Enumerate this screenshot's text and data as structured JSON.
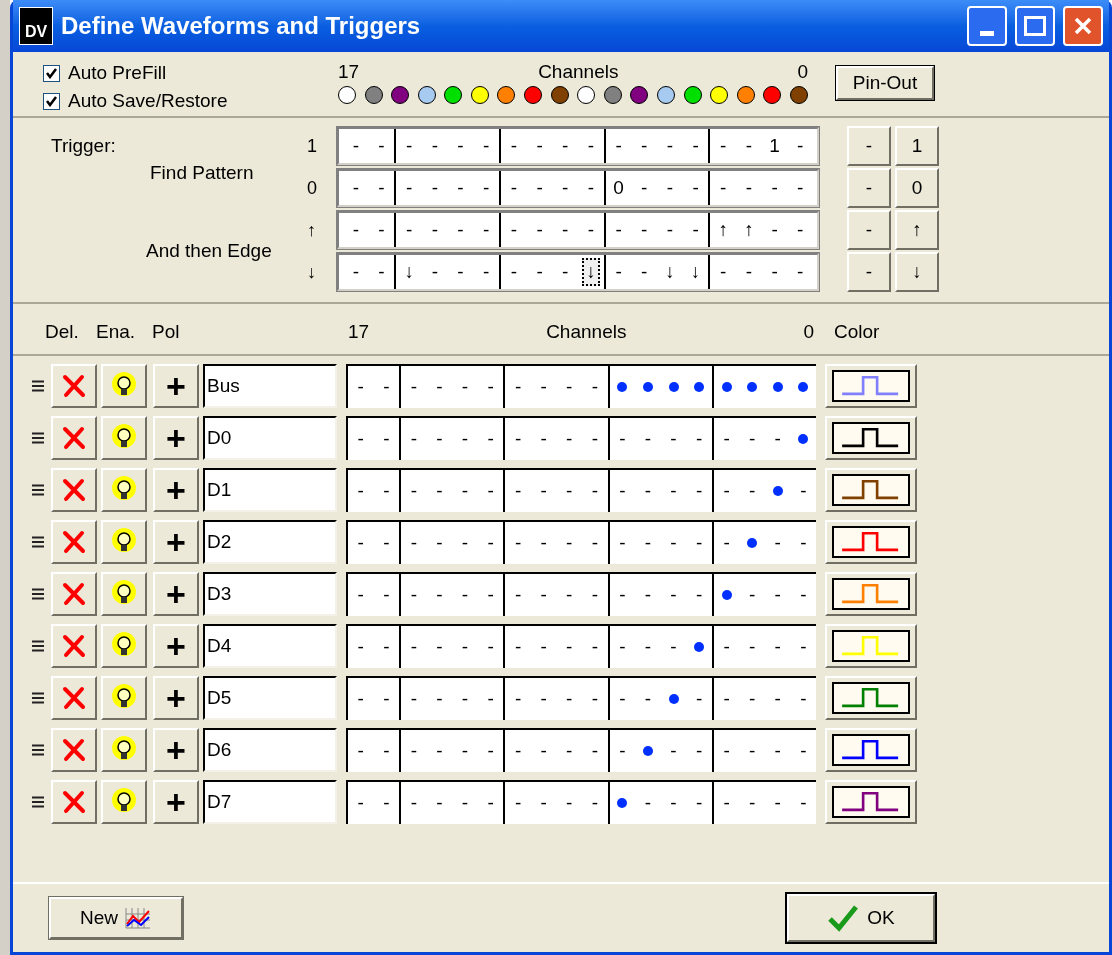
{
  "window": {
    "title": "Define Waveforms and Triggers",
    "logo": "DV"
  },
  "options": [
    {
      "label": "Auto PreFill",
      "checked": true
    },
    {
      "label": "Auto Save/Restore",
      "checked": true
    }
  ],
  "channel_range": {
    "high": "17",
    "caption": "Channels",
    "low": "0"
  },
  "channel_colors": [
    {
      "color": "#ffffff"
    },
    {
      "color": "#808080"
    },
    {
      "color": "#800080"
    },
    {
      "color": "#a6caf0"
    },
    {
      "color": "#00e000"
    },
    {
      "color": "#ffff00"
    },
    {
      "color": "#ff8000"
    },
    {
      "color": "#ff0000"
    },
    {
      "color": "#804000"
    },
    {
      "color": "#ffffff"
    },
    {
      "color": "#808080"
    },
    {
      "color": "#800080"
    },
    {
      "color": "#a6caf0"
    },
    {
      "color": "#00e000"
    },
    {
      "color": "#ffff00"
    },
    {
      "color": "#ff8000"
    },
    {
      "color": "#ff0000"
    },
    {
      "color": "#804000"
    }
  ],
  "pin_out_button": "Pin-Out",
  "trigger": {
    "label": "Trigger:",
    "pattern_label": "Find Pattern",
    "edge_label": "And then Edge",
    "rows": [
      {
        "symbol": "1",
        "buttons": [
          "-",
          "1"
        ],
        "cells": [
          {
            "text": "-",
            "focused": false
          },
          {
            "text": "-",
            "focused": false
          },
          {
            "text": "-",
            "focused": false
          },
          {
            "text": "-",
            "focused": false
          },
          {
            "text": "-",
            "focused": false
          },
          {
            "text": "-",
            "focused": false
          },
          {
            "text": "-",
            "focused": false
          },
          {
            "text": "-",
            "focused": false
          },
          {
            "text": "-",
            "focused": false
          },
          {
            "text": "-",
            "focused": false
          },
          {
            "text": "-",
            "focused": false
          },
          {
            "text": "-",
            "focused": false
          },
          {
            "text": "-",
            "focused": false
          },
          {
            "text": "-",
            "focused": false
          },
          {
            "text": "-",
            "focused": false
          },
          {
            "text": "-",
            "focused": false
          },
          {
            "text": "1",
            "focused": false
          },
          {
            "text": "-",
            "focused": false
          }
        ]
      },
      {
        "symbol": "0",
        "buttons": [
          "-",
          "0"
        ],
        "cells": [
          {
            "text": "-",
            "focused": false
          },
          {
            "text": "-",
            "focused": false
          },
          {
            "text": "-",
            "focused": false
          },
          {
            "text": "-",
            "focused": false
          },
          {
            "text": "-",
            "focused": false
          },
          {
            "text": "-",
            "focused": false
          },
          {
            "text": "-",
            "focused": false
          },
          {
            "text": "-",
            "focused": false
          },
          {
            "text": "-",
            "focused": false
          },
          {
            "text": "-",
            "focused": false
          },
          {
            "text": "0",
            "focused": false
          },
          {
            "text": "-",
            "focused": false
          },
          {
            "text": "-",
            "focused": false
          },
          {
            "text": "-",
            "focused": false
          },
          {
            "text": "-",
            "focused": false
          },
          {
            "text": "-",
            "focused": false
          },
          {
            "text": "-",
            "focused": false
          },
          {
            "text": "-",
            "focused": false
          }
        ]
      },
      {
        "symbol": "↑",
        "buttons": [
          "-",
          "↑"
        ],
        "cells": [
          {
            "text": "-",
            "focused": false
          },
          {
            "text": "-",
            "focused": false
          },
          {
            "text": "-",
            "focused": false
          },
          {
            "text": "-",
            "focused": false
          },
          {
            "text": "-",
            "focused": false
          },
          {
            "text": "-",
            "focused": false
          },
          {
            "text": "-",
            "focused": false
          },
          {
            "text": "-",
            "focused": false
          },
          {
            "text": "-",
            "focused": false
          },
          {
            "text": "-",
            "focused": false
          },
          {
            "text": "-",
            "focused": false
          },
          {
            "text": "-",
            "focused": false
          },
          {
            "text": "-",
            "focused": false
          },
          {
            "text": "-",
            "focused": false
          },
          {
            "text": "↑",
            "focused": false
          },
          {
            "text": "↑",
            "focused": false
          },
          {
            "text": "-",
            "focused": false
          },
          {
            "text": "-",
            "focused": false
          }
        ]
      },
      {
        "symbol": "↓",
        "buttons": [
          "-",
          "↓"
        ],
        "cells": [
          {
            "text": "-",
            "focused": false
          },
          {
            "text": "-",
            "focused": false
          },
          {
            "text": "↓",
            "focused": false
          },
          {
            "text": "-",
            "focused": false
          },
          {
            "text": "-",
            "focused": false
          },
          {
            "text": "-",
            "focused": false
          },
          {
            "text": "-",
            "focused": false
          },
          {
            "text": "-",
            "focused": false
          },
          {
            "text": "-",
            "focused": false
          },
          {
            "text": "↓",
            "focused": true
          },
          {
            "text": "-",
            "focused": false
          },
          {
            "text": "-",
            "focused": false
          },
          {
            "text": "↓",
            "focused": false
          },
          {
            "text": "↓",
            "focused": false
          },
          {
            "text": "-",
            "focused": false
          },
          {
            "text": "-",
            "focused": false
          },
          {
            "text": "-",
            "focused": false
          },
          {
            "text": "-",
            "focused": false
          }
        ]
      }
    ]
  },
  "table": {
    "columns": [
      "Del.",
      "Ena.",
      "Pol"
    ],
    "range": {
      "high": "17",
      "caption": "Channels",
      "low": "0"
    },
    "color_column": "Color",
    "rows": [
      {
        "name": "Bus",
        "polarity": "+",
        "color": "#8080ff",
        "cells": [
          {
            "kind": "dash",
            "text": "-"
          },
          {
            "kind": "dash",
            "text": "-"
          },
          {
            "kind": "dash",
            "text": "-"
          },
          {
            "kind": "dash",
            "text": "-"
          },
          {
            "kind": "dash",
            "text": "-"
          },
          {
            "kind": "dash",
            "text": "-"
          },
          {
            "kind": "dash",
            "text": "-"
          },
          {
            "kind": "dash",
            "text": "-"
          },
          {
            "kind": "dash",
            "text": "-"
          },
          {
            "kind": "dash",
            "text": "-"
          },
          {
            "kind": "dot"
          },
          {
            "kind": "dot"
          },
          {
            "kind": "dot"
          },
          {
            "kind": "dot"
          },
          {
            "kind": "dot"
          },
          {
            "kind": "dot"
          },
          {
            "kind": "dot"
          },
          {
            "kind": "dot"
          }
        ]
      },
      {
        "name": "D0",
        "polarity": "+",
        "color": "#000000",
        "cells": [
          {
            "kind": "dash",
            "text": "-"
          },
          {
            "kind": "dash",
            "text": "-"
          },
          {
            "kind": "dash",
            "text": "-"
          },
          {
            "kind": "dash",
            "text": "-"
          },
          {
            "kind": "dash",
            "text": "-"
          },
          {
            "kind": "dash",
            "text": "-"
          },
          {
            "kind": "dash",
            "text": "-"
          },
          {
            "kind": "dash",
            "text": "-"
          },
          {
            "kind": "dash",
            "text": "-"
          },
          {
            "kind": "dash",
            "text": "-"
          },
          {
            "kind": "dash",
            "text": "-"
          },
          {
            "kind": "dash",
            "text": "-"
          },
          {
            "kind": "dash",
            "text": "-"
          },
          {
            "kind": "dash",
            "text": "-"
          },
          {
            "kind": "dash",
            "text": "-"
          },
          {
            "kind": "dash",
            "text": "-"
          },
          {
            "kind": "dash",
            "text": "-"
          },
          {
            "kind": "dot"
          }
        ]
      },
      {
        "name": "D1",
        "polarity": "+",
        "color": "#804000",
        "cells": [
          {
            "kind": "dash",
            "text": "-"
          },
          {
            "kind": "dash",
            "text": "-"
          },
          {
            "kind": "dash",
            "text": "-"
          },
          {
            "kind": "dash",
            "text": "-"
          },
          {
            "kind": "dash",
            "text": "-"
          },
          {
            "kind": "dash",
            "text": "-"
          },
          {
            "kind": "dash",
            "text": "-"
          },
          {
            "kind": "dash",
            "text": "-"
          },
          {
            "kind": "dash",
            "text": "-"
          },
          {
            "kind": "dash",
            "text": "-"
          },
          {
            "kind": "dash",
            "text": "-"
          },
          {
            "kind": "dash",
            "text": "-"
          },
          {
            "kind": "dash",
            "text": "-"
          },
          {
            "kind": "dash",
            "text": "-"
          },
          {
            "kind": "dash",
            "text": "-"
          },
          {
            "kind": "dash",
            "text": "-"
          },
          {
            "kind": "dot"
          },
          {
            "kind": "dash",
            "text": "-"
          }
        ]
      },
      {
        "name": "D2",
        "polarity": "+",
        "color": "#ff0000",
        "cells": [
          {
            "kind": "dash",
            "text": "-"
          },
          {
            "kind": "dash",
            "text": "-"
          },
          {
            "kind": "dash",
            "text": "-"
          },
          {
            "kind": "dash",
            "text": "-"
          },
          {
            "kind": "dash",
            "text": "-"
          },
          {
            "kind": "dash",
            "text": "-"
          },
          {
            "kind": "dash",
            "text": "-"
          },
          {
            "kind": "dash",
            "text": "-"
          },
          {
            "kind": "dash",
            "text": "-"
          },
          {
            "kind": "dash",
            "text": "-"
          },
          {
            "kind": "dash",
            "text": "-"
          },
          {
            "kind": "dash",
            "text": "-"
          },
          {
            "kind": "dash",
            "text": "-"
          },
          {
            "kind": "dash",
            "text": "-"
          },
          {
            "kind": "dash",
            "text": "-"
          },
          {
            "kind": "dot"
          },
          {
            "kind": "dash",
            "text": "-"
          },
          {
            "kind": "dash",
            "text": "-"
          }
        ]
      },
      {
        "name": "D3",
        "polarity": "+",
        "color": "#ff8000",
        "cells": [
          {
            "kind": "dash",
            "text": "-"
          },
          {
            "kind": "dash",
            "text": "-"
          },
          {
            "kind": "dash",
            "text": "-"
          },
          {
            "kind": "dash",
            "text": "-"
          },
          {
            "kind": "dash",
            "text": "-"
          },
          {
            "kind": "dash",
            "text": "-"
          },
          {
            "kind": "dash",
            "text": "-"
          },
          {
            "kind": "dash",
            "text": "-"
          },
          {
            "kind": "dash",
            "text": "-"
          },
          {
            "kind": "dash",
            "text": "-"
          },
          {
            "kind": "dash",
            "text": "-"
          },
          {
            "kind": "dash",
            "text": "-"
          },
          {
            "kind": "dash",
            "text": "-"
          },
          {
            "kind": "dash",
            "text": "-"
          },
          {
            "kind": "dot"
          },
          {
            "kind": "dash",
            "text": "-"
          },
          {
            "kind": "dash",
            "text": "-"
          },
          {
            "kind": "dash",
            "text": "-"
          }
        ]
      },
      {
        "name": "D4",
        "polarity": "+",
        "color": "#ffff00",
        "cells": [
          {
            "kind": "dash",
            "text": "-"
          },
          {
            "kind": "dash",
            "text": "-"
          },
          {
            "kind": "dash",
            "text": "-"
          },
          {
            "kind": "dash",
            "text": "-"
          },
          {
            "kind": "dash",
            "text": "-"
          },
          {
            "kind": "dash",
            "text": "-"
          },
          {
            "kind": "dash",
            "text": "-"
          },
          {
            "kind": "dash",
            "text": "-"
          },
          {
            "kind": "dash",
            "text": "-"
          },
          {
            "kind": "dash",
            "text": "-"
          },
          {
            "kind": "dash",
            "text": "-"
          },
          {
            "kind": "dash",
            "text": "-"
          },
          {
            "kind": "dash",
            "text": "-"
          },
          {
            "kind": "dot"
          },
          {
            "kind": "dash",
            "text": "-"
          },
          {
            "kind": "dash",
            "text": "-"
          },
          {
            "kind": "dash",
            "text": "-"
          },
          {
            "kind": "dash",
            "text": "-"
          }
        ]
      },
      {
        "name": "D5",
        "polarity": "+",
        "color": "#008000",
        "cells": [
          {
            "kind": "dash",
            "text": "-"
          },
          {
            "kind": "dash",
            "text": "-"
          },
          {
            "kind": "dash",
            "text": "-"
          },
          {
            "kind": "dash",
            "text": "-"
          },
          {
            "kind": "dash",
            "text": "-"
          },
          {
            "kind": "dash",
            "text": "-"
          },
          {
            "kind": "dash",
            "text": "-"
          },
          {
            "kind": "dash",
            "text": "-"
          },
          {
            "kind": "dash",
            "text": "-"
          },
          {
            "kind": "dash",
            "text": "-"
          },
          {
            "kind": "dash",
            "text": "-"
          },
          {
            "kind": "dash",
            "text": "-"
          },
          {
            "kind": "dot"
          },
          {
            "kind": "dash",
            "text": "-"
          },
          {
            "kind": "dash",
            "text": "-"
          },
          {
            "kind": "dash",
            "text": "-"
          },
          {
            "kind": "dash",
            "text": "-"
          },
          {
            "kind": "dash",
            "text": "-"
          }
        ]
      },
      {
        "name": "D6",
        "polarity": "+",
        "color": "#0000ff",
        "cells": [
          {
            "kind": "dash",
            "text": "-"
          },
          {
            "kind": "dash",
            "text": "-"
          },
          {
            "kind": "dash",
            "text": "-"
          },
          {
            "kind": "dash",
            "text": "-"
          },
          {
            "kind": "dash",
            "text": "-"
          },
          {
            "kind": "dash",
            "text": "-"
          },
          {
            "kind": "dash",
            "text": "-"
          },
          {
            "kind": "dash",
            "text": "-"
          },
          {
            "kind": "dash",
            "text": "-"
          },
          {
            "kind": "dash",
            "text": "-"
          },
          {
            "kind": "dash",
            "text": "-"
          },
          {
            "kind": "dot"
          },
          {
            "kind": "dash",
            "text": "-"
          },
          {
            "kind": "dash",
            "text": "-"
          },
          {
            "kind": "dash",
            "text": "-"
          },
          {
            "kind": "dash",
            "text": "-"
          },
          {
            "kind": "dash",
            "text": "-"
          },
          {
            "kind": "dash",
            "text": "-"
          }
        ]
      },
      {
        "name": "D7",
        "polarity": "+",
        "color": "#800080",
        "cells": [
          {
            "kind": "dash",
            "text": "-"
          },
          {
            "kind": "dash",
            "text": "-"
          },
          {
            "kind": "dash",
            "text": "-"
          },
          {
            "kind": "dash",
            "text": "-"
          },
          {
            "kind": "dash",
            "text": "-"
          },
          {
            "kind": "dash",
            "text": "-"
          },
          {
            "kind": "dash",
            "text": "-"
          },
          {
            "kind": "dash",
            "text": "-"
          },
          {
            "kind": "dash",
            "text": "-"
          },
          {
            "kind": "dash",
            "text": "-"
          },
          {
            "kind": "dot"
          },
          {
            "kind": "dash",
            "text": "-"
          },
          {
            "kind": "dash",
            "text": "-"
          },
          {
            "kind": "dash",
            "text": "-"
          },
          {
            "kind": "dash",
            "text": "-"
          },
          {
            "kind": "dash",
            "text": "-"
          },
          {
            "kind": "dash",
            "text": "-"
          },
          {
            "kind": "dash",
            "text": "-"
          }
        ]
      }
    ]
  },
  "buttons": {
    "new": "New",
    "ok": "OK"
  }
}
